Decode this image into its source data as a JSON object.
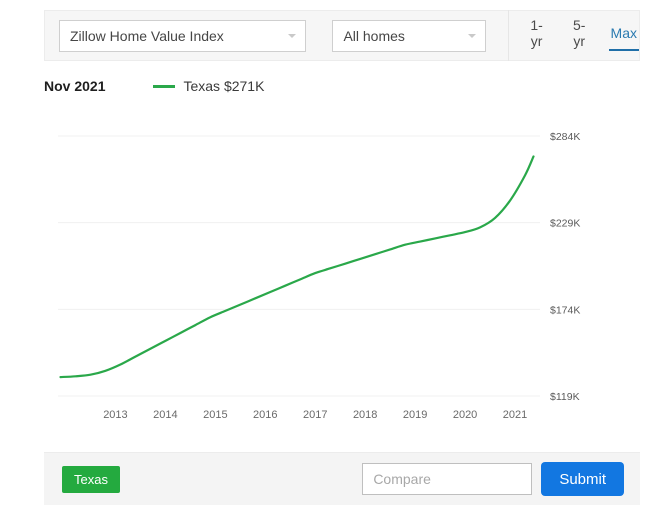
{
  "toolbar": {
    "metric_select": {
      "value": "Zillow Home Value Index",
      "caret": "chevron-down-icon"
    },
    "hometype_select": {
      "value": "All homes",
      "caret": "chevron-down-icon"
    },
    "ranges": [
      {
        "label": "1-yr",
        "active": false
      },
      {
        "label": "5-yr",
        "active": false
      },
      {
        "label": "Max",
        "active": true
      }
    ]
  },
  "legend": {
    "date": "Nov 2021",
    "series_label": "Texas $271K",
    "series_color": "#2aa84a"
  },
  "bottom": {
    "chip_label": "Texas",
    "chip_color": "#24aa3f",
    "compare_placeholder": "Compare",
    "compare_value": "",
    "submit_label": "Submit",
    "submit_color": "#1277e1"
  },
  "chart_data": {
    "type": "line",
    "title": "",
    "xlabel": "",
    "ylabel": "",
    "grid": true,
    "legend_position": "top-left",
    "ylim": [
      119000,
      284000
    ],
    "ytick_labels": [
      "$284K",
      "$229K",
      "$174K",
      "$119K"
    ],
    "ytick_values": [
      284000,
      229000,
      174000,
      119000
    ],
    "xtick_labels": [
      "2013",
      "2014",
      "2015",
      "2016",
      "2017",
      "2018",
      "2019",
      "2020",
      "2021"
    ],
    "xlim": [
      2012.35,
      2022.0
    ],
    "series": [
      {
        "name": "Texas",
        "color": "#2aa84a",
        "x": [
          2012.4,
          2012.7,
          2013.0,
          2013.3,
          2013.6,
          2013.9,
          2014.2,
          2014.5,
          2014.8,
          2015.1,
          2015.4,
          2015.7,
          2016.0,
          2016.3,
          2016.6,
          2016.9,
          2017.2,
          2017.5,
          2017.8,
          2018.1,
          2018.4,
          2018.7,
          2019.0,
          2019.3,
          2019.6,
          2019.9,
          2020.2,
          2020.5,
          2020.8,
          2021.1,
          2021.4,
          2021.7,
          2021.87
        ],
        "values": [
          131000,
          131500,
          132500,
          135000,
          139000,
          144000,
          149000,
          154000,
          159000,
          164000,
          169000,
          173000,
          177000,
          181000,
          185000,
          189000,
          193000,
          197000,
          200000,
          203000,
          206000,
          209000,
          212000,
          215000,
          217000,
          219000,
          221000,
          223000,
          226000,
          232000,
          243000,
          259000,
          271000
        ]
      }
    ]
  }
}
